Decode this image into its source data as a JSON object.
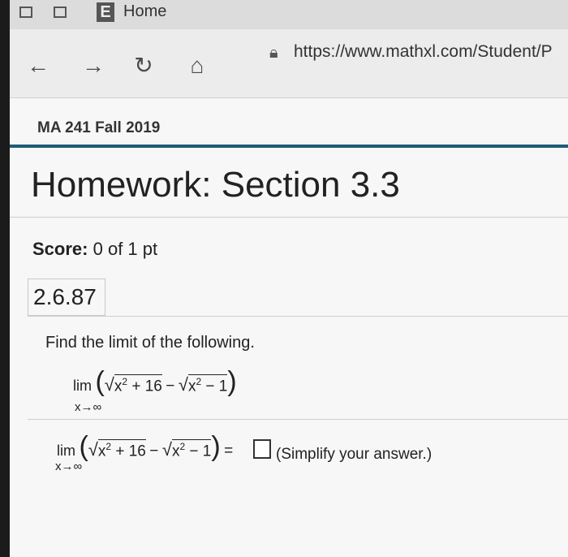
{
  "browser": {
    "tab_title": "Home",
    "tab_letter": "E",
    "url": "https://www.mathxl.com/Student/P",
    "nav_icons": [
      "back-arrow-icon",
      "forward-arrow-icon",
      "refresh-icon",
      "home-icon",
      "lock-icon"
    ]
  },
  "page": {
    "course": "MA 241 Fall 2019",
    "title": "Homework: Section 3.3",
    "score_label": "Score:",
    "score_value": "0 of 1 pt",
    "question_number": "2.6.87",
    "instruction": "Find the limit of the following."
  },
  "problem": {
    "lim": "lim",
    "subscript": "x→∞",
    "term1": "x",
    "term1_exp": "2",
    "term1_tail": " + 16",
    "minus": "−",
    "term2": "x",
    "term2_exp": "2",
    "term2_tail": " − 1",
    "equals": "=",
    "hint": "(Simplify your answer.)"
  },
  "colors": {
    "course_rule": "#1f5c78"
  }
}
